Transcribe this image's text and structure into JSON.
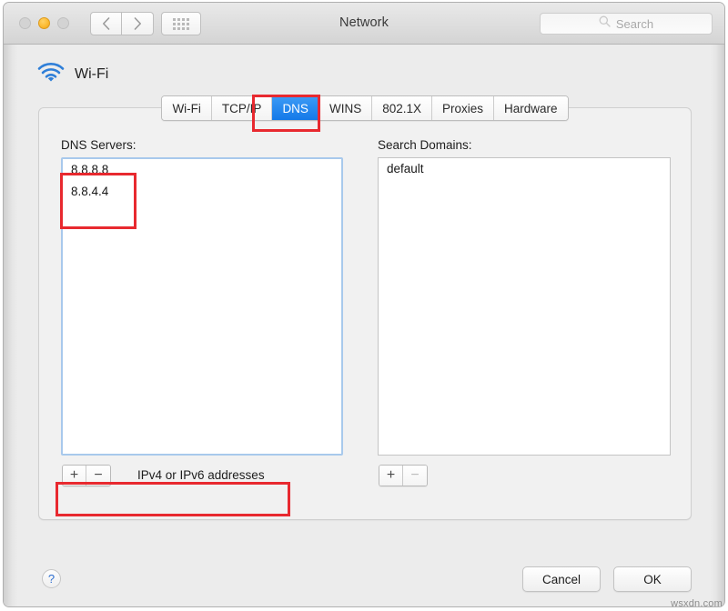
{
  "window": {
    "title": "Network",
    "traffic_lights": [
      "close",
      "minimize",
      "zoom"
    ],
    "search": {
      "placeholder": "Search"
    }
  },
  "service": {
    "name": "Wi-Fi",
    "icon": "wifi-icon"
  },
  "tabs": [
    {
      "label": "Wi-Fi",
      "active": false
    },
    {
      "label": "TCP/IP",
      "active": false
    },
    {
      "label": "DNS",
      "active": true
    },
    {
      "label": "WINS",
      "active": false
    },
    {
      "label": "802.1X",
      "active": false
    },
    {
      "label": "Proxies",
      "active": false
    },
    {
      "label": "Hardware",
      "active": false
    }
  ],
  "dns_panel": {
    "servers_label": "DNS Servers:",
    "servers": [
      "8.8.8.8",
      "8.8.4.4"
    ],
    "servers_hint": "IPv4 or IPv6 addresses",
    "servers_add": "+",
    "servers_remove": "−",
    "domains_label": "Search Domains:",
    "domains": [
      "default"
    ],
    "domains_add": "+",
    "domains_remove": "−"
  },
  "footer": {
    "help": "?",
    "cancel": "Cancel",
    "ok": "OK"
  },
  "watermark": "wsxdn.com",
  "colors": {
    "accent_blue": "#1479e8",
    "annotation_red": "#e8292f",
    "focus_ring": "#a8c9ec",
    "wifi_icon": "#2f7fd8"
  }
}
